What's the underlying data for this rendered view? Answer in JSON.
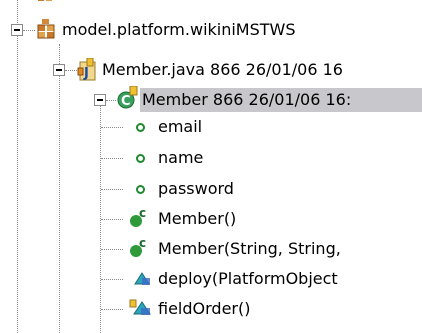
{
  "tree": {
    "package": {
      "label": "model.platform.wikiniMSTWS",
      "icon": "package-icon"
    },
    "compilation_unit": {
      "label": "Member.java 866  26/01/06 16",
      "icon": "java-file-icon"
    },
    "class_node": {
      "label": "Member 866  26/01/06 16:",
      "icon": "class-icon"
    },
    "members": [
      {
        "label": "email",
        "icon": "public-field-icon"
      },
      {
        "label": "name",
        "icon": "public-field-icon"
      },
      {
        "label": "password",
        "icon": "public-field-icon"
      },
      {
        "label": "Member()",
        "icon": "constructor-icon"
      },
      {
        "label": "Member(String, String,",
        "icon": "constructor-icon"
      },
      {
        "label": "deploy(PlatformObject",
        "icon": "default-method-icon"
      },
      {
        "label": "fieldOrder()",
        "icon": "default-method-icon"
      }
    ]
  },
  "colors": {
    "selection": "#c8c8cc",
    "field_green": "#1e8a2e",
    "constructor_green": "#2e9a3a",
    "package_orange": "#c87a2a"
  }
}
